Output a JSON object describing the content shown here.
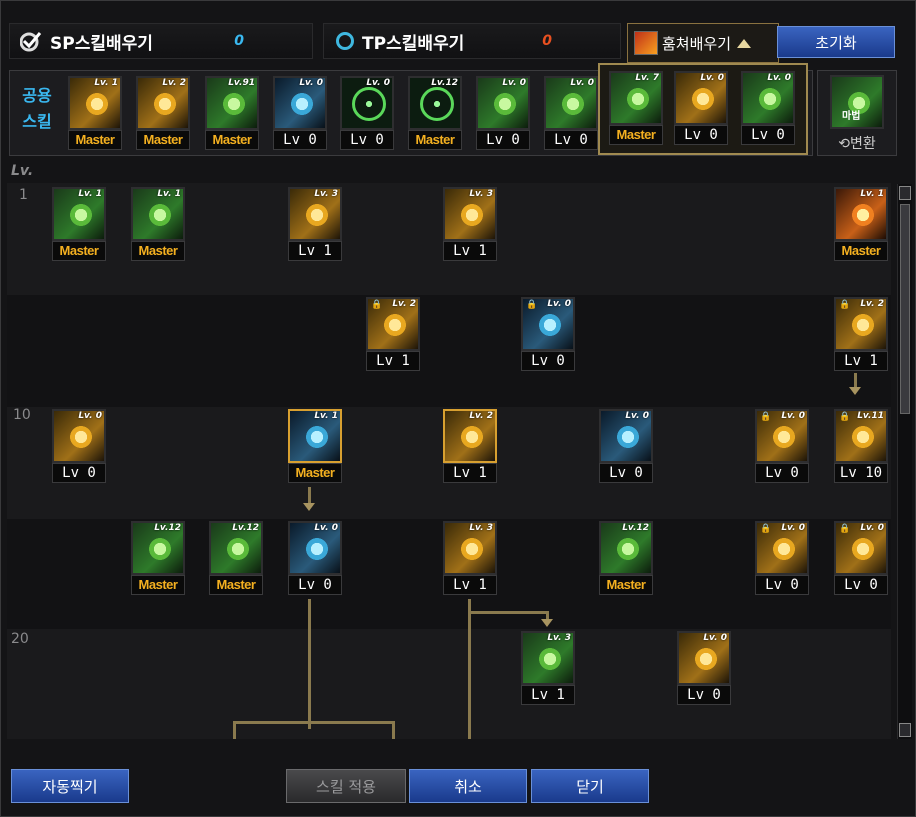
{
  "top": {
    "sp_label": "SP스킬배우기",
    "sp_value": "0",
    "tp_label": "TP스킬배우기",
    "tp_value": "0",
    "steal_label": "훔쳐배우기",
    "reset_label": "초기화"
  },
  "common": {
    "label_line1": "공용",
    "label_line2": "스킬",
    "convert_label": "⟲변환",
    "convert_icon_text": "마법",
    "skills": [
      {
        "lv": "Lv. 1",
        "label": "Master",
        "style": "g-gold"
      },
      {
        "lv": "Lv. 2",
        "label": "Master",
        "style": "g-gold"
      },
      {
        "lv": "Lv.91",
        "label": "Master",
        "style": "g-green"
      },
      {
        "lv": "Lv. 0",
        "label": "Lv 0",
        "style": "g-blue"
      },
      {
        "lv": "Lv. 0",
        "label": "Lv 0",
        "style": "g-target"
      },
      {
        "lv": "Lv.12",
        "label": "Master",
        "style": "g-target"
      },
      {
        "lv": "Lv. 0",
        "label": "Lv 0",
        "style": "g-green"
      },
      {
        "lv": "Lv. 0",
        "label": "Lv 0",
        "style": "g-green"
      },
      {
        "lv": "Lv. 7",
        "label": "Master",
        "style": "g-green"
      },
      {
        "lv": "Lv. 0",
        "label": "Lv 0",
        "style": "g-gold"
      },
      {
        "lv": "Lv. 0",
        "label": "Lv 0",
        "style": "g-green"
      }
    ]
  },
  "tree": {
    "lv_header": "Lv.",
    "row_labels": [
      "1",
      "10",
      "20"
    ],
    "skills": [
      {
        "lv": "Lv. 1",
        "label": "Master",
        "style": "g-green"
      },
      {
        "lv": "Lv. 1",
        "label": "Master",
        "style": "g-green"
      },
      {
        "lv": "Lv. 3",
        "label": "Lv 1",
        "style": "g-gold"
      },
      {
        "lv": "Lv. 3",
        "label": "Lv 1",
        "style": "g-gold"
      },
      {
        "lv": "Lv. 1",
        "label": "Master",
        "style": "g-fire"
      },
      {
        "lv": "Lv. 2",
        "label": "Lv 1",
        "style": "g-gold",
        "lock": true
      },
      {
        "lv": "Lv. 0",
        "label": "Lv 0",
        "style": "g-blue",
        "lock": true
      },
      {
        "lv": "Lv. 2",
        "label": "Lv 1",
        "style": "g-gold",
        "lock": true
      },
      {
        "lv": "Lv. 0",
        "label": "Lv 0",
        "style": "g-gold"
      },
      {
        "lv": "Lv. 1",
        "label": "Master",
        "style": "g-blue",
        "hl": true
      },
      {
        "lv": "Lv. 2",
        "label": "Lv 1",
        "style": "g-gold",
        "hl": true
      },
      {
        "lv": "Lv. 0",
        "label": "Lv 0",
        "style": "g-blue"
      },
      {
        "lv": "Lv. 0",
        "label": "Lv 0",
        "style": "g-gold",
        "lock": true
      },
      {
        "lv": "Lv.11",
        "label": "Lv 10",
        "style": "g-gold",
        "lock": true
      },
      {
        "lv": "Lv.12",
        "label": "Master",
        "style": "g-green"
      },
      {
        "lv": "Lv.12",
        "label": "Master",
        "style": "g-green"
      },
      {
        "lv": "Lv. 0",
        "label": "Lv 0",
        "style": "g-blue"
      },
      {
        "lv": "Lv. 3",
        "label": "Lv 1",
        "style": "g-gold"
      },
      {
        "lv": "Lv.12",
        "label": "Master",
        "style": "g-green"
      },
      {
        "lv": "Lv. 0",
        "label": "Lv 0",
        "style": "g-gold",
        "lock": true
      },
      {
        "lv": "Lv. 0",
        "label": "Lv 0",
        "style": "g-gold",
        "lock": true
      },
      {
        "lv": "Lv. 3",
        "label": "Lv 1",
        "style": "g-green"
      },
      {
        "lv": "Lv. 0",
        "label": "Lv 0",
        "style": "g-gold"
      }
    ]
  },
  "buttons": {
    "auto": "자동찍기",
    "apply": "스킬 적용",
    "cancel": "취소",
    "close": "닫기"
  },
  "colors": {
    "sp_value": "#3ab8f0",
    "tp_value": "#e85020",
    "master": "#f4b020",
    "accent_blue": "#3a64c0",
    "line": "#8a7a4e"
  }
}
